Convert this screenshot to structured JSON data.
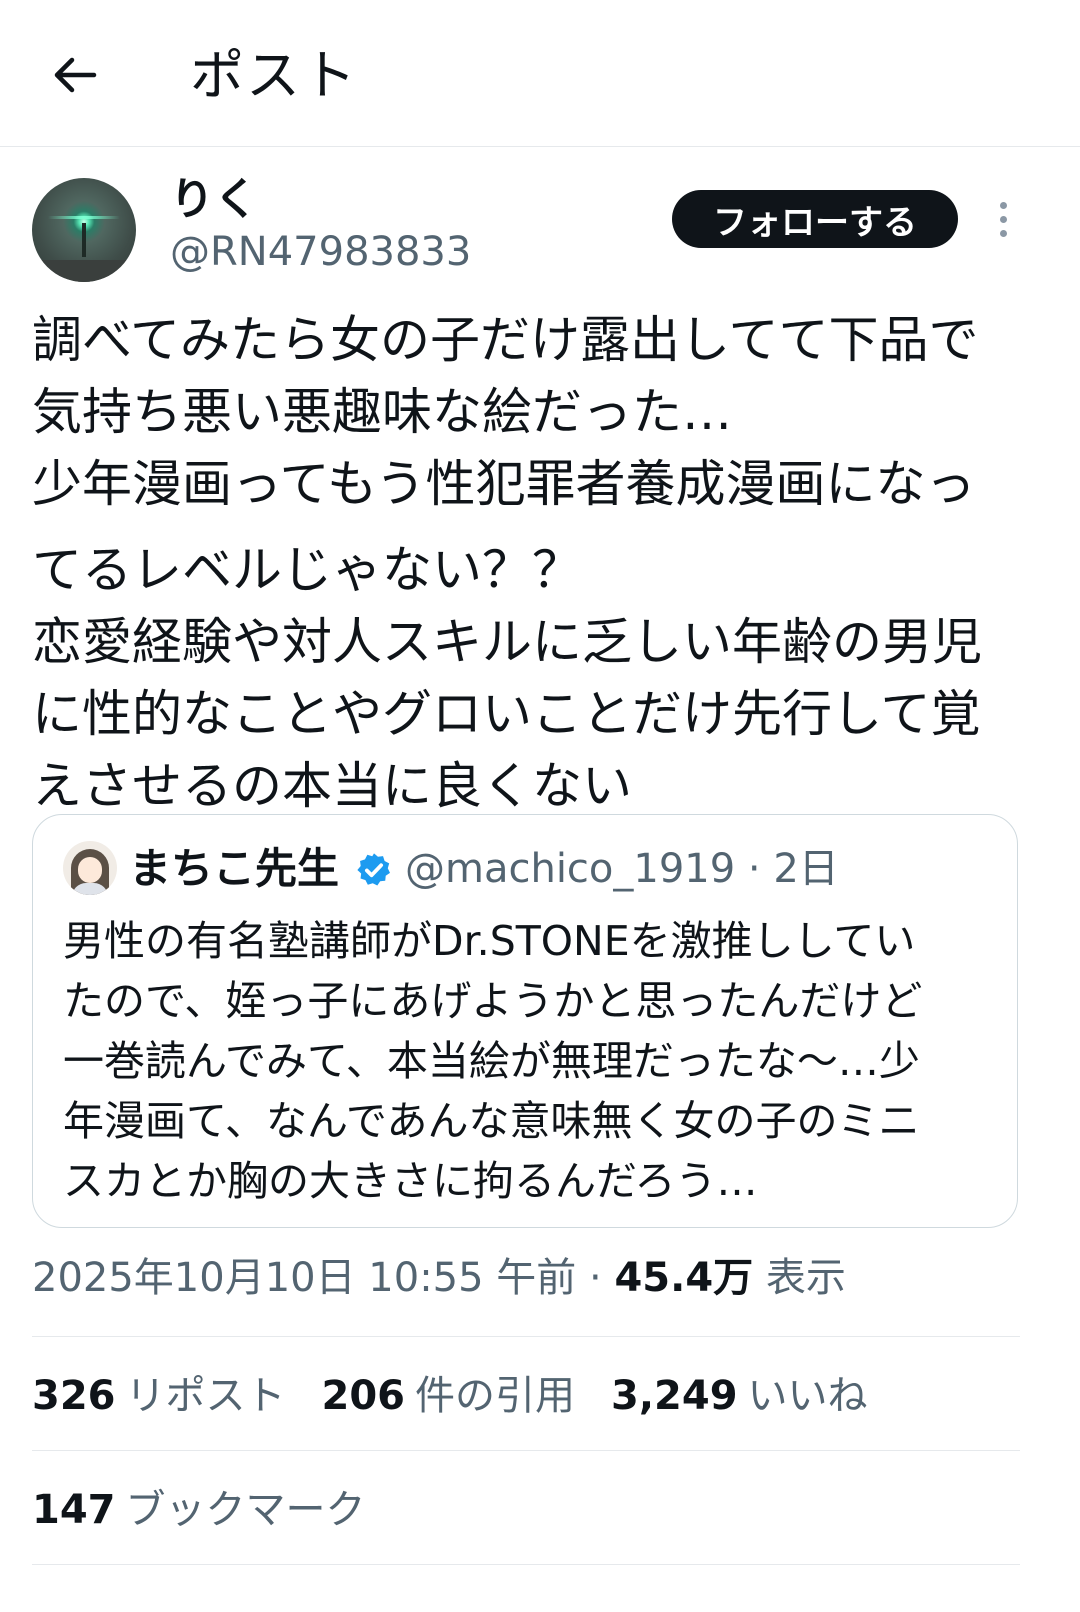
{
  "header": {
    "title": "ポスト",
    "back_icon": "arrow-left-icon"
  },
  "author": {
    "display_name": "りく",
    "handle": "@RN47983833",
    "follow_label": "フォローする",
    "more_icon": "more-vertical-icon"
  },
  "post": {
    "lines": [
      "調べてみたら女の子だけ露出してて下品で",
      "気持ち悪い悪趣味な絵だった…",
      "少年漫画ってもう性犯罪者養成漫画になっ",
      "てるレベルじゃない？？",
      "恋愛経験や対人スキルに乏しい年齢の男児",
      "に性的なことやグロいことだけ先行して覚",
      "えさせるの本当に良くない"
    ]
  },
  "quote": {
    "display_name": "まちこ先生",
    "verified_icon": "verified-badge-icon",
    "meta": "@machico_1919 · 2日",
    "lines": [
      "男性の有名塾講師がDr.STONEを激推ししてい",
      "たので、姪っ子にあげようかと思ったんだけど",
      "一巻読んでみて、本当絵が無理だったな〜…少",
      "年漫画て、なんであんな意味無く女の子のミニ",
      "スカとか胸の大きさに拘るんだろう…"
    ]
  },
  "meta": {
    "timestamp": "2025年10月10日 10:55 午前 · ",
    "views_count": "45.4万",
    "views_label": " 表示"
  },
  "stats": {
    "reposts_count": "326",
    "reposts_label": "リポスト",
    "quotes_count": "206",
    "quotes_label": "件の引用",
    "likes_count": "3,249",
    "likes_label": "いいね",
    "bookmarks_count": "147",
    "bookmarks_label": "ブックマーク"
  },
  "colors": {
    "text": "#0f1419",
    "secondary": "#536471",
    "border": "#cfd9de",
    "verified": "#1d9bf0",
    "follow_bg": "#0f1419"
  }
}
